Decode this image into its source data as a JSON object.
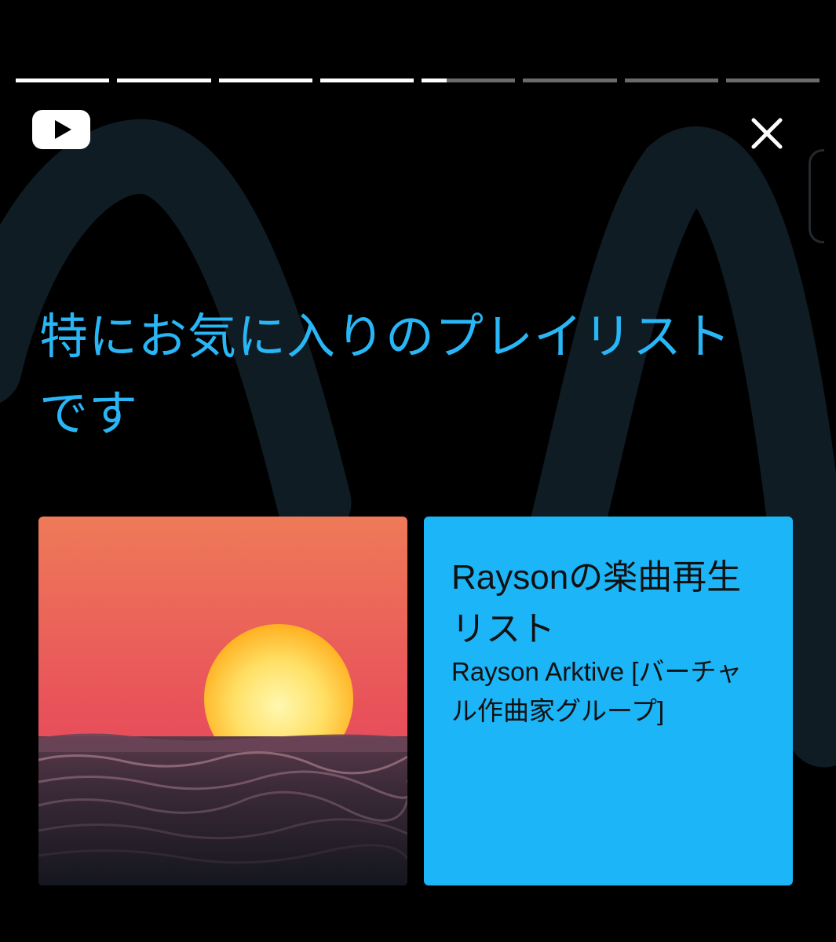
{
  "story": {
    "segments_total": 8,
    "segments_complete": 4,
    "current_segment_progress": 0.27
  },
  "colors": {
    "background": "#000000",
    "accent": "#29b6f6",
    "card": "#1cb5f8",
    "swoosh": "#0f1c24"
  },
  "icons": {
    "logo": "youtube-play-icon",
    "close": "close-icon"
  },
  "headline": "特にお気に入りのプレイリストです",
  "playlist": {
    "title": "Raysonの楽曲再生リスト",
    "channel": "Rayson Arktive [バーチャル作曲家グループ]",
    "thumbnail": "sunset-over-ocean"
  }
}
